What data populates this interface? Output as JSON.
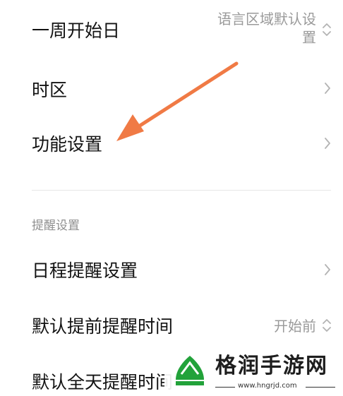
{
  "rows": [
    {
      "label": "一周开始日",
      "value_line1": "语言区域默认设",
      "value_line2": "置",
      "control": "up-down"
    },
    {
      "label": "时区",
      "control": "right"
    },
    {
      "label": "功能设置",
      "control": "right"
    }
  ],
  "section": {
    "header": "提醒设置",
    "rows": [
      {
        "label": "日程提醒设置",
        "control": "right"
      },
      {
        "label": "默认提前提醒时间",
        "value": "开始前",
        "control": "up-down"
      },
      {
        "label": "默认全天提醒时间"
      }
    ]
  },
  "watermark": {
    "title": "格润手游网",
    "domain": "www.hngrjd.com"
  },
  "colors": {
    "arrow": "#f07a45",
    "label": "#121212",
    "secondary": "#9a9a9a",
    "watermark_green": "#22a23a"
  }
}
